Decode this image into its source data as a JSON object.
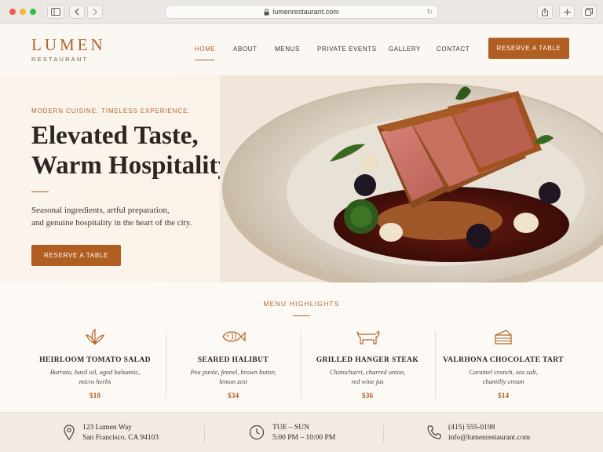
{
  "browser": {
    "url": "lumenrestaurant.com"
  },
  "brand": {
    "name": "LUMEN",
    "sub": "RESTAURANT"
  },
  "nav": {
    "items": [
      "HOME",
      "ABOUT",
      "MENUS",
      "PRIVATE EVENTS",
      "GALLERY",
      "CONTACT"
    ],
    "cta": "RESERVE A TABLE"
  },
  "hero": {
    "tagline": "MODERN CUISINE.  TIMELESS EXPERIENCE.",
    "title_line1": "Elevated Taste,",
    "title_line2": "Warm Hospitality",
    "desc_line1": "Seasonal ingredients, artful preparation,",
    "desc_line2": "and genuine hospitality in the heart of the city.",
    "cta": "RESERVE A TABLE"
  },
  "highlights": {
    "title": "MENU HIGHLIGHTS",
    "items": [
      {
        "icon": "leaf-icon",
        "name": "HEIRLOOM TOMATO SALAD",
        "desc1": "Burrata, basil oil, aged balsamic,",
        "desc2": "micro herbs",
        "price": "$18"
      },
      {
        "icon": "fish-icon",
        "name": "SEARED HALIBUT",
        "desc1": "Pea purée, fennel, brown butter,",
        "desc2": "lemon zest",
        "price": "$34"
      },
      {
        "icon": "cow-icon",
        "name": "GRILLED HANGER STEAK",
        "desc1": "Chimichurri, charred onion,",
        "desc2": "red wine jus",
        "price": "$36"
      },
      {
        "icon": "cake-icon",
        "name": "VALRHONA CHOCOLATE TART",
        "desc1": "Caramel crunch, sea salt,",
        "desc2": "chantilly cream",
        "price": "$14"
      }
    ]
  },
  "footer": {
    "address1": "123 Lumen Way",
    "address2": "San Francisco, CA 94103",
    "hours1": "TUE – SUN",
    "hours2": "5:00 PM – 10:00 PM",
    "phone": "(415) 555-0198",
    "email": "info@lumenrestaurant.com"
  },
  "colors": {
    "accent": "#b15e22",
    "background": "#fbf7f1"
  }
}
